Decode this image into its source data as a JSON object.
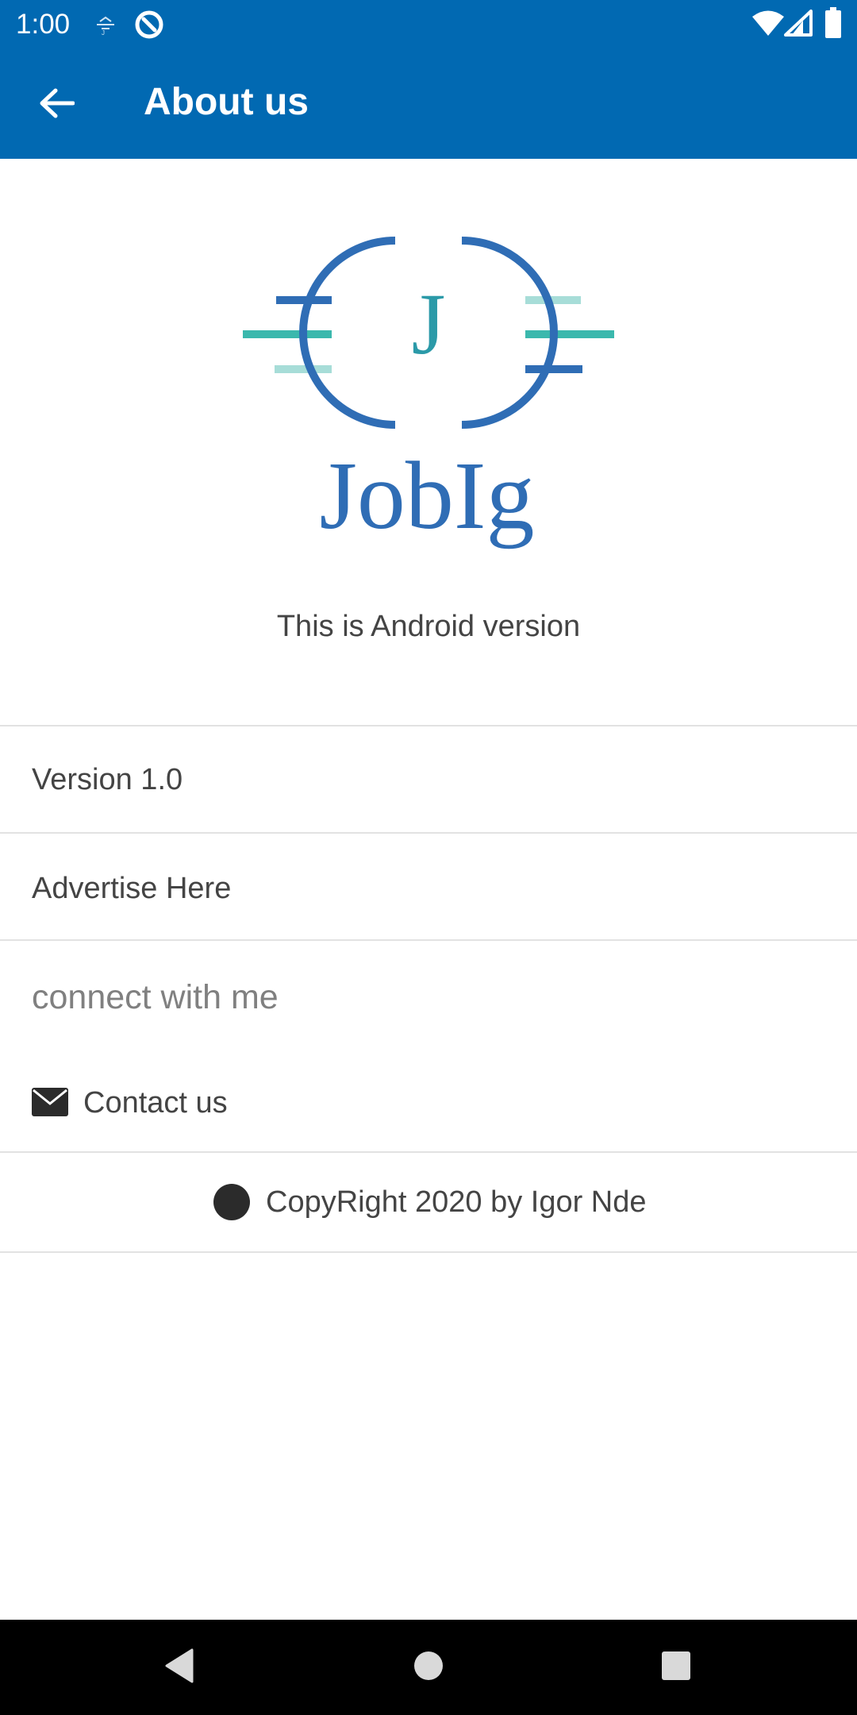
{
  "status_bar": {
    "time": "1:00",
    "icons": [
      "app-notification-icon",
      "data-saver-icon",
      "wifi-icon",
      "cellular-signal-icon",
      "battery-icon"
    ]
  },
  "app_bar": {
    "back_icon": "arrow-back-icon",
    "title": "About us"
  },
  "logo": {
    "letter": "J",
    "wordmark": "JobIg",
    "colors": {
      "blue": "#2f6db5",
      "teal": "#3bb8ad",
      "light_teal": "#a7ddd8"
    }
  },
  "tagline": "This is Android version",
  "list": {
    "version": "Version 1.0",
    "advertise": "Advertise Here"
  },
  "connect": {
    "heading": "connect with me",
    "contact_icon": "envelope-icon",
    "contact_label": "Contact us"
  },
  "footer": {
    "copyright_icon": "copyright-icon",
    "copyright_text": "CopyRight 2020 by Igor Nde"
  },
  "nav_bar": {
    "buttons": [
      "back-triangle-icon",
      "home-circle-icon",
      "recents-square-icon"
    ]
  },
  "colors": {
    "primary": "#0169b2",
    "divider": "#e2e2e2",
    "text": "#444444",
    "muted_text": "#808080"
  }
}
